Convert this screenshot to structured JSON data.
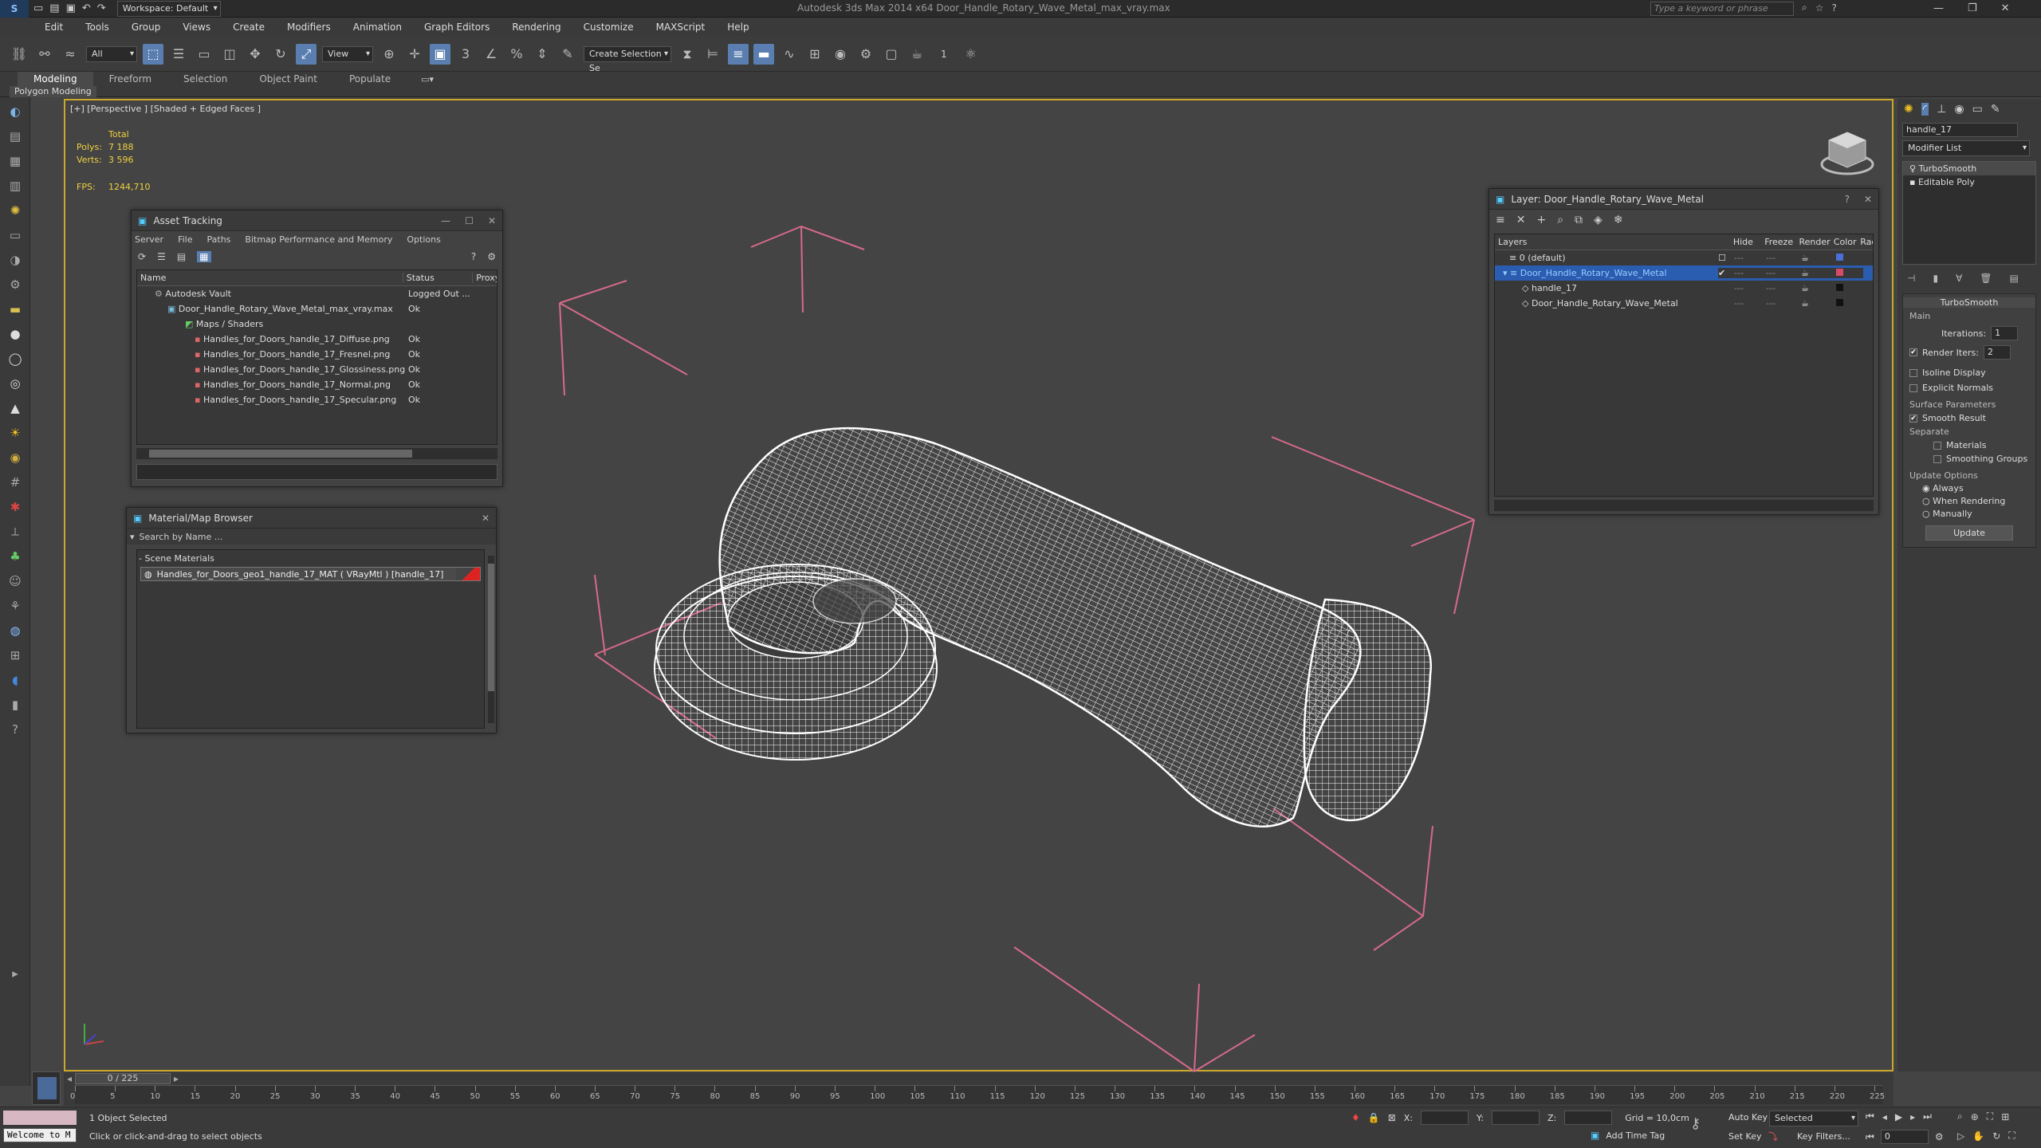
{
  "app": {
    "workspace": "Workspace: Default",
    "title": "Autodesk 3ds Max 2014 x64    Door_Handle_Rotary_Wave_Metal_max_vray.max",
    "search_placeholder": "Type a keyword or phrase"
  },
  "menu": [
    "Edit",
    "Tools",
    "Group",
    "Views",
    "Create",
    "Modifiers",
    "Animation",
    "Graph Editors",
    "Rendering",
    "Customize",
    "MAXScript",
    "Help"
  ],
  "toolbar": {
    "filter": "All",
    "refcoord": "View",
    "selection_set": "Create Selection Se",
    "angle_snap": "1"
  },
  "ribbon": {
    "tabs": [
      "Modeling",
      "Freeform",
      "Selection",
      "Object Paint",
      "Populate"
    ],
    "subtitle": "Polygon Modeling"
  },
  "viewport": {
    "label": "[+] [Perspective ] [Shaded + Edged Faces ]",
    "stats": {
      "total_label": "Total",
      "polys_label": "Polys:",
      "polys": "7 188",
      "verts_label": "Verts:",
      "verts": "3 596",
      "fps_label": "FPS:",
      "fps": "1244,710"
    }
  },
  "asset_tracking": {
    "title": "Asset Tracking",
    "menu": [
      "Server",
      "File",
      "Paths",
      "Bitmap Performance and Memory",
      "Options"
    ],
    "columns": [
      "Name",
      "Status",
      "Proxy"
    ],
    "rows": [
      {
        "name": "Autodesk Vault",
        "status": "Logged Out ..."
      },
      {
        "name": "Door_Handle_Rotary_Wave_Metal_max_vray.max",
        "status": "Ok"
      },
      {
        "name": "Maps / Shaders",
        "status": ""
      },
      {
        "name": "Handles_for_Doors_handle_17_Diffuse.png",
        "status": "Ok"
      },
      {
        "name": "Handles_for_Doors_handle_17_Fresnel.png",
        "status": "Ok"
      },
      {
        "name": "Handles_for_Doors_handle_17_Glossiness.png",
        "status": "Ok"
      },
      {
        "name": "Handles_for_Doors_handle_17_Normal.png",
        "status": "Ok"
      },
      {
        "name": "Handles_for_Doors_handle_17_Specular.png",
        "status": "Ok"
      }
    ]
  },
  "material_browser": {
    "title": "Material/Map Browser",
    "search_placeholder": "Search by Name ...",
    "section": "- Scene Materials",
    "item": "Handles_for_Doors_geo1_handle_17_MAT ( VRayMtl ) [handle_17]"
  },
  "layer_window": {
    "title": "Layer: Door_Handle_Rotary_Wave_Metal",
    "columns": [
      "Layers",
      "Hide",
      "Freeze",
      "Render",
      "Color",
      "Rad"
    ],
    "rows": [
      {
        "name": "0 (default)",
        "color": "#4a6fd8"
      },
      {
        "name": "Door_Handle_Rotary_Wave_Metal",
        "color": "#d84a6a"
      },
      {
        "name": "handle_17",
        "color": "#111111"
      },
      {
        "name": "Door_Handle_Rotary_Wave_Metal",
        "color": "#111111"
      }
    ]
  },
  "command_panel": {
    "object_name": "handle_17",
    "modifier_list": "Modifier List",
    "stack": [
      "TurboSmooth",
      "Editable Poly"
    ],
    "rollout": "TurboSmooth",
    "main": "Main",
    "iterations_label": "Iterations:",
    "iterations": "1",
    "render_iters_label": "Render Iters:",
    "render_iters": "2",
    "isoline": "Isoline Display",
    "explicit_normals": "Explicit Normals",
    "surface_params": "Surface Parameters",
    "smooth_result": "Smooth Result",
    "separate": "Separate",
    "materials": "Materials",
    "smoothing_groups": "Smoothing Groups",
    "update_options": "Update Options",
    "always": "Always",
    "when_rendering": "When Rendering",
    "manually": "Manually",
    "update_button": "Update"
  },
  "timeline": {
    "frame": "0 / 225",
    "ticks": [
      "0",
      "5",
      "10",
      "15",
      "20",
      "25",
      "30",
      "35",
      "40",
      "45",
      "50",
      "55",
      "60",
      "65",
      "70",
      "75",
      "80",
      "85",
      "90",
      "95",
      "100",
      "105",
      "110",
      "115",
      "120",
      "125",
      "130",
      "135",
      "140",
      "145",
      "150",
      "155",
      "160",
      "165",
      "170",
      "175",
      "180",
      "185",
      "190",
      "195",
      "200",
      "205",
      "210",
      "215",
      "220",
      "225"
    ]
  },
  "status": {
    "welcome": "Welcome to M",
    "selected": "1 Object Selected",
    "hint": "Click or click-and-drag to select objects",
    "x_label": "X:",
    "y_label": "Y:",
    "z_label": "Z:",
    "grid": "Grid = 10,0cm",
    "add_time_tag": "Add Time Tag",
    "auto_key": "Auto Key",
    "selected_dd": "Selected",
    "set_key": "Set Key",
    "key_filters": "Key Filters...",
    "frame_field": "0"
  }
}
